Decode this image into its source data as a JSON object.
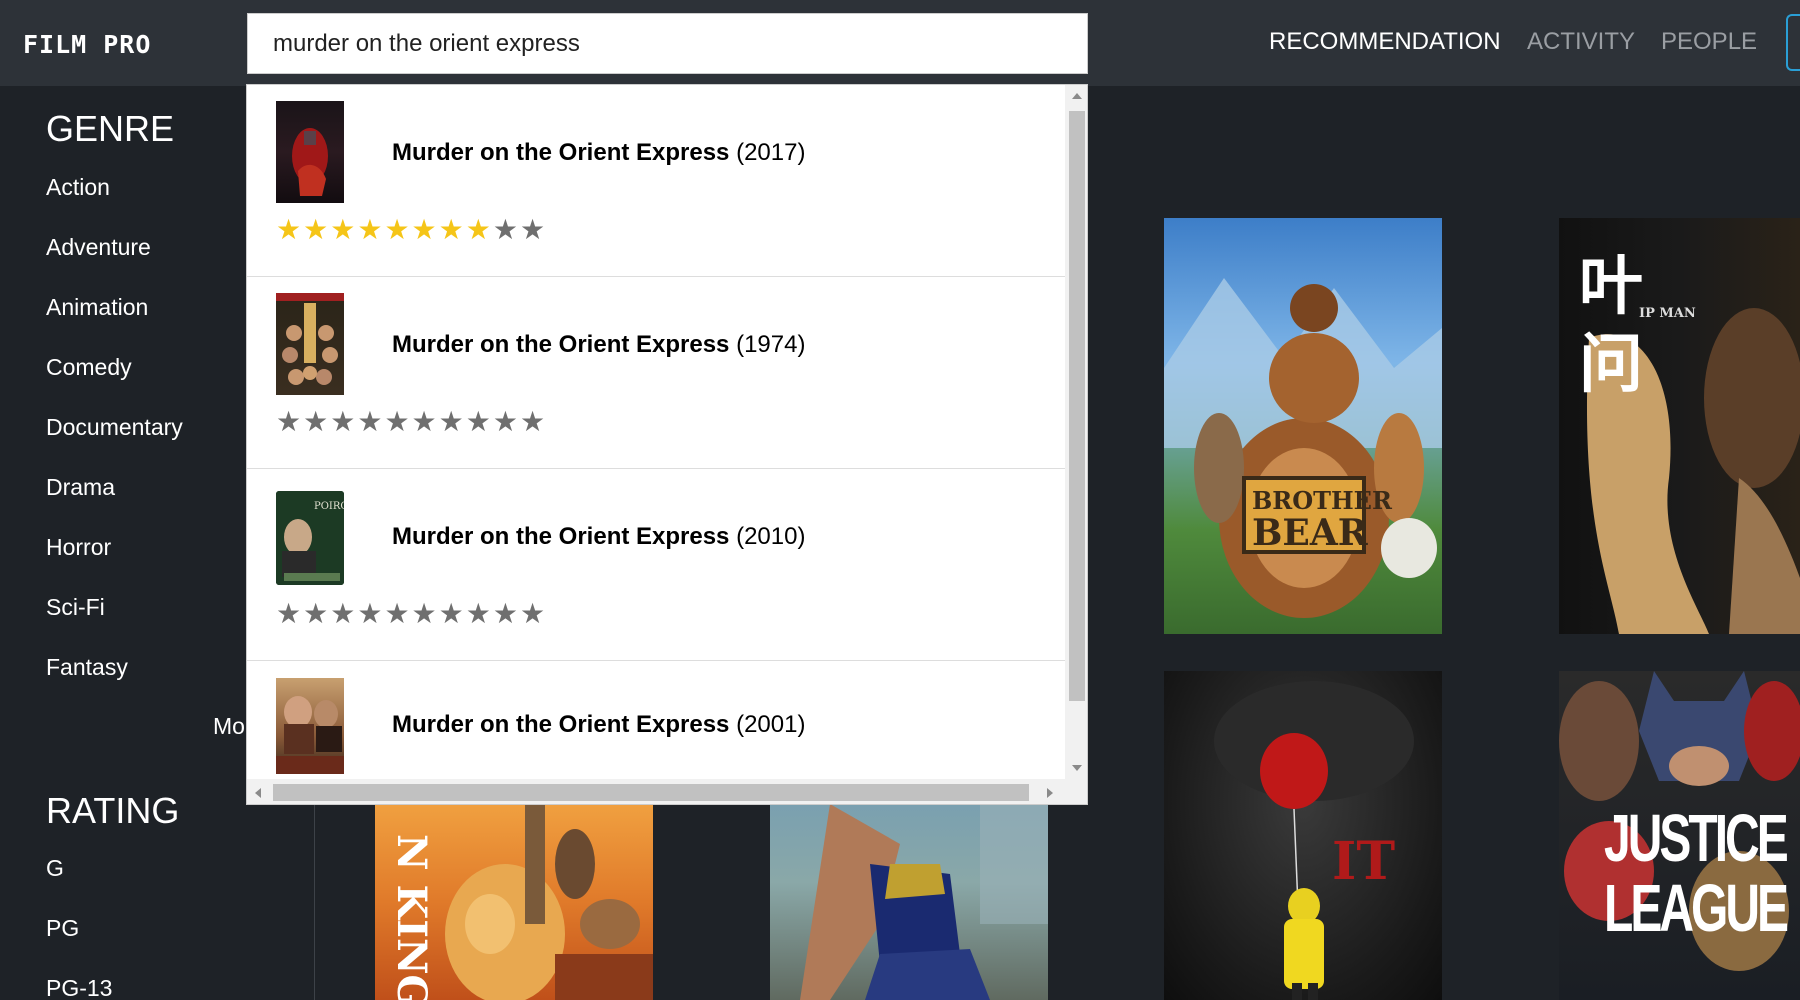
{
  "header": {
    "logo": "FILM PRO",
    "search_value": "murder on the orient express",
    "nav": [
      {
        "label": "RECOMMENDATION",
        "active": true
      },
      {
        "label": "ACTIVITY",
        "active": false
      },
      {
        "label": "PEOPLE",
        "active": false
      }
    ]
  },
  "sidebar": {
    "genre_heading": "GENRE",
    "genres": [
      "Action",
      "Adventure",
      "Animation",
      "Comedy",
      "Documentary",
      "Drama",
      "Horror",
      "Sci-Fi",
      "Fantasy"
    ],
    "more_label": "Mo",
    "rating_heading": "RATING",
    "ratings": [
      "G",
      "PG",
      "PG-13"
    ]
  },
  "search_results": [
    {
      "title": "Murder on the Orient Express",
      "year": "(2017)",
      "rating": 8,
      "max_rating": 10
    },
    {
      "title": "Murder on the Orient Express",
      "year": "(1974)",
      "rating": 0,
      "max_rating": 10
    },
    {
      "title": "Murder on the Orient Express",
      "year": "(2010)",
      "rating": 0,
      "max_rating": 10
    },
    {
      "title": "Murder on the Orient Express",
      "year": "(2001)"
    }
  ],
  "thumb_texts": {
    "poirot": "POIROT"
  },
  "posters": {
    "brother_bear": {
      "line1": "BROTHER",
      "line2": "BEAR"
    },
    "ip_man": {
      "chars": "叶 问",
      "subtitle": "IP MAN"
    },
    "lion_king": {
      "text": "N KING"
    },
    "it": {
      "text": "IT"
    },
    "justice_league": {
      "line1": "JUSTICE",
      "line2": "LEAGUE"
    }
  },
  "colors": {
    "star_on": "#f5c518",
    "star_off": "#6f6f6f",
    "header_bg": "#2d3238",
    "page_bg": "#1e2227",
    "accent": "#2a9fd6"
  }
}
